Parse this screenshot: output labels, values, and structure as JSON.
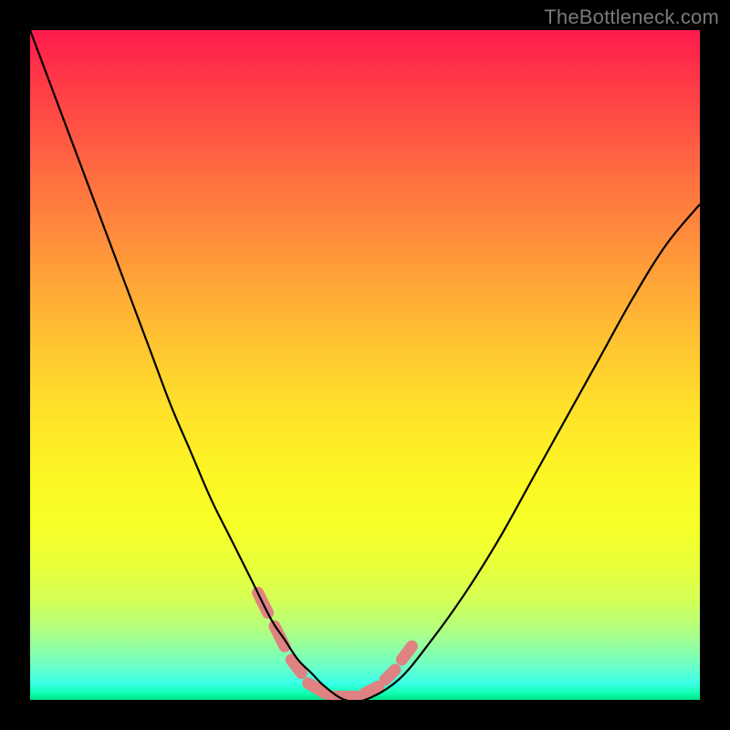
{
  "watermark": "TheBottleneck.com",
  "chart_data": {
    "type": "line",
    "title": "",
    "xlabel": "",
    "ylabel": "",
    "xlim": [
      0,
      100
    ],
    "ylim": [
      0,
      100
    ],
    "background_gradient": {
      "top": "#ff1a4d",
      "mid": "#ffe02a",
      "bottom": "#00e28a"
    },
    "series": [
      {
        "name": "black-curve",
        "type": "line",
        "color": "#000000",
        "x": [
          0,
          3,
          6,
          9,
          12,
          15,
          18,
          21,
          24,
          27,
          30,
          33,
          36,
          38,
          40,
          42,
          44,
          47,
          50,
          55,
          60,
          65,
          70,
          75,
          80,
          85,
          90,
          95,
          100
        ],
        "y": [
          100,
          92,
          84,
          76,
          68,
          60,
          52,
          44,
          37,
          30,
          24,
          18,
          12,
          9,
          6,
          4,
          2,
          0,
          0,
          3,
          9,
          16,
          24,
          33,
          42,
          51,
          60,
          68,
          74
        ]
      },
      {
        "name": "pink-highlight",
        "type": "line",
        "color": "#de8282",
        "description": "thick dashed overlay near the minimum of the curve",
        "segments": [
          {
            "x": [
              34,
              35.5
            ],
            "y": [
              16,
              13
            ]
          },
          {
            "x": [
              36.5,
              38
            ],
            "y": [
              11,
              8
            ]
          },
          {
            "x": [
              39,
              40.5
            ],
            "y": [
              6,
              4
            ]
          },
          {
            "x": [
              41.5,
              44
            ],
            "y": [
              2.5,
              1
            ]
          },
          {
            "x": [
              45,
              49
            ],
            "y": [
              0.5,
              0.5
            ]
          },
          {
            "x": [
              50,
              52
            ],
            "y": [
              1,
              2
            ]
          },
          {
            "x": [
              53,
              54.5
            ],
            "y": [
              3,
              4.5
            ]
          },
          {
            "x": [
              55.5,
              57
            ],
            "y": [
              6,
              8
            ]
          }
        ]
      }
    ]
  }
}
